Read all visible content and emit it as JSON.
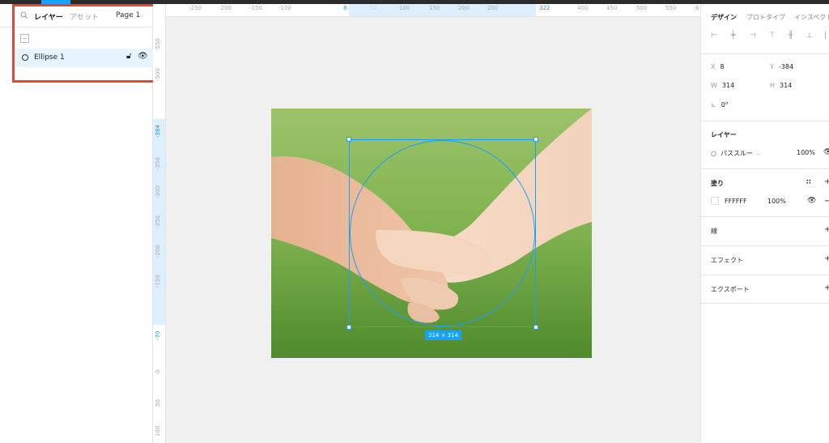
{
  "left_panel": {
    "tab_layers": "レイヤー",
    "tab_assets": "アセット",
    "page": "Page 1",
    "layer_name": "Ellipse 1"
  },
  "rulers": {
    "horizontal": [
      "-250",
      "-200",
      "-150",
      "-100",
      "8",
      "50",
      "100",
      "150",
      "200",
      "250",
      "322",
      "400",
      "450",
      "500",
      "550",
      "6"
    ],
    "vertical": [
      "-550",
      "-500",
      "-384",
      "-350",
      "-300",
      "-250",
      "-200",
      "-150",
      "-70",
      "0",
      "50",
      "100"
    ]
  },
  "canvas": {
    "size_badge": "314 × 314"
  },
  "right_panel": {
    "tab_design": "デザイン",
    "tab_prototype": "プロトタイプ",
    "tab_inspect": "インスペクト",
    "x_label": "X",
    "x_value": "8",
    "y_label": "Y",
    "y_value": "-384",
    "w_label": "W",
    "w_value": "314",
    "h_label": "H",
    "h_value": "314",
    "rotation": "0°",
    "layer_title": "レイヤー",
    "blend_mode": "パススルー",
    "layer_opacity": "100%",
    "fill_title": "塗り",
    "fill_hex": "FFFFFF",
    "fill_opacity": "100%",
    "stroke_title": "線",
    "effect_title": "エフェクト",
    "export_title": "エクスポート"
  },
  "colors": {
    "accent": "#18a0fb",
    "highlight": "#e8472f"
  }
}
